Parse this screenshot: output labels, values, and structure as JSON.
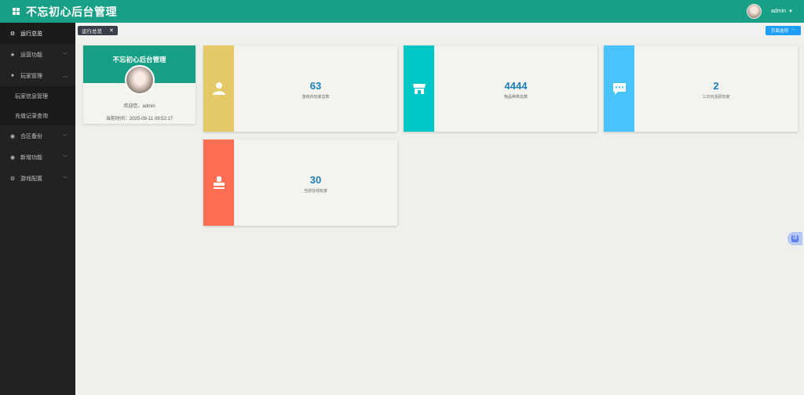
{
  "header": {
    "title": "不忘初心后台管理",
    "user": "admin"
  },
  "sidebar": {
    "items": [
      {
        "label": "运行总览",
        "icon": "gear-icon"
      },
      {
        "label": "运营功能",
        "icon": "star-icon"
      },
      {
        "label": "玩家管理",
        "icon": "user-icon"
      },
      {
        "label": "合区备份",
        "icon": "eye-icon"
      },
      {
        "label": "新增功能",
        "icon": "eye-icon"
      },
      {
        "label": "游戏配置",
        "icon": "gear-icon"
      }
    ],
    "subitems": [
      "玩家信息管理",
      "充值记录查询"
    ]
  },
  "tabs": {
    "current": "运行总览",
    "close": "✕",
    "page_ops": "页面选项"
  },
  "profile": {
    "title": "不忘初心后台管理",
    "welcome": "欢迎您，admin",
    "time_label": "当前时间：2025-09-11 09:52:17"
  },
  "stats": [
    {
      "value": "63",
      "label": "游戏内玩家总数",
      "color": "#e4c966",
      "icon": "user-icon"
    },
    {
      "value": "4444",
      "label": "物品种类总数",
      "color": "#00c6c5",
      "icon": "store-icon"
    },
    {
      "value": "2",
      "label": "三日内活跃玩家",
      "color": "#48c4fb",
      "icon": "chat-icon"
    },
    {
      "value": "30",
      "label": "当前在线玩家",
      "color": "#ff6d52",
      "icon": "stamp-icon"
    }
  ],
  "float_button": "译"
}
